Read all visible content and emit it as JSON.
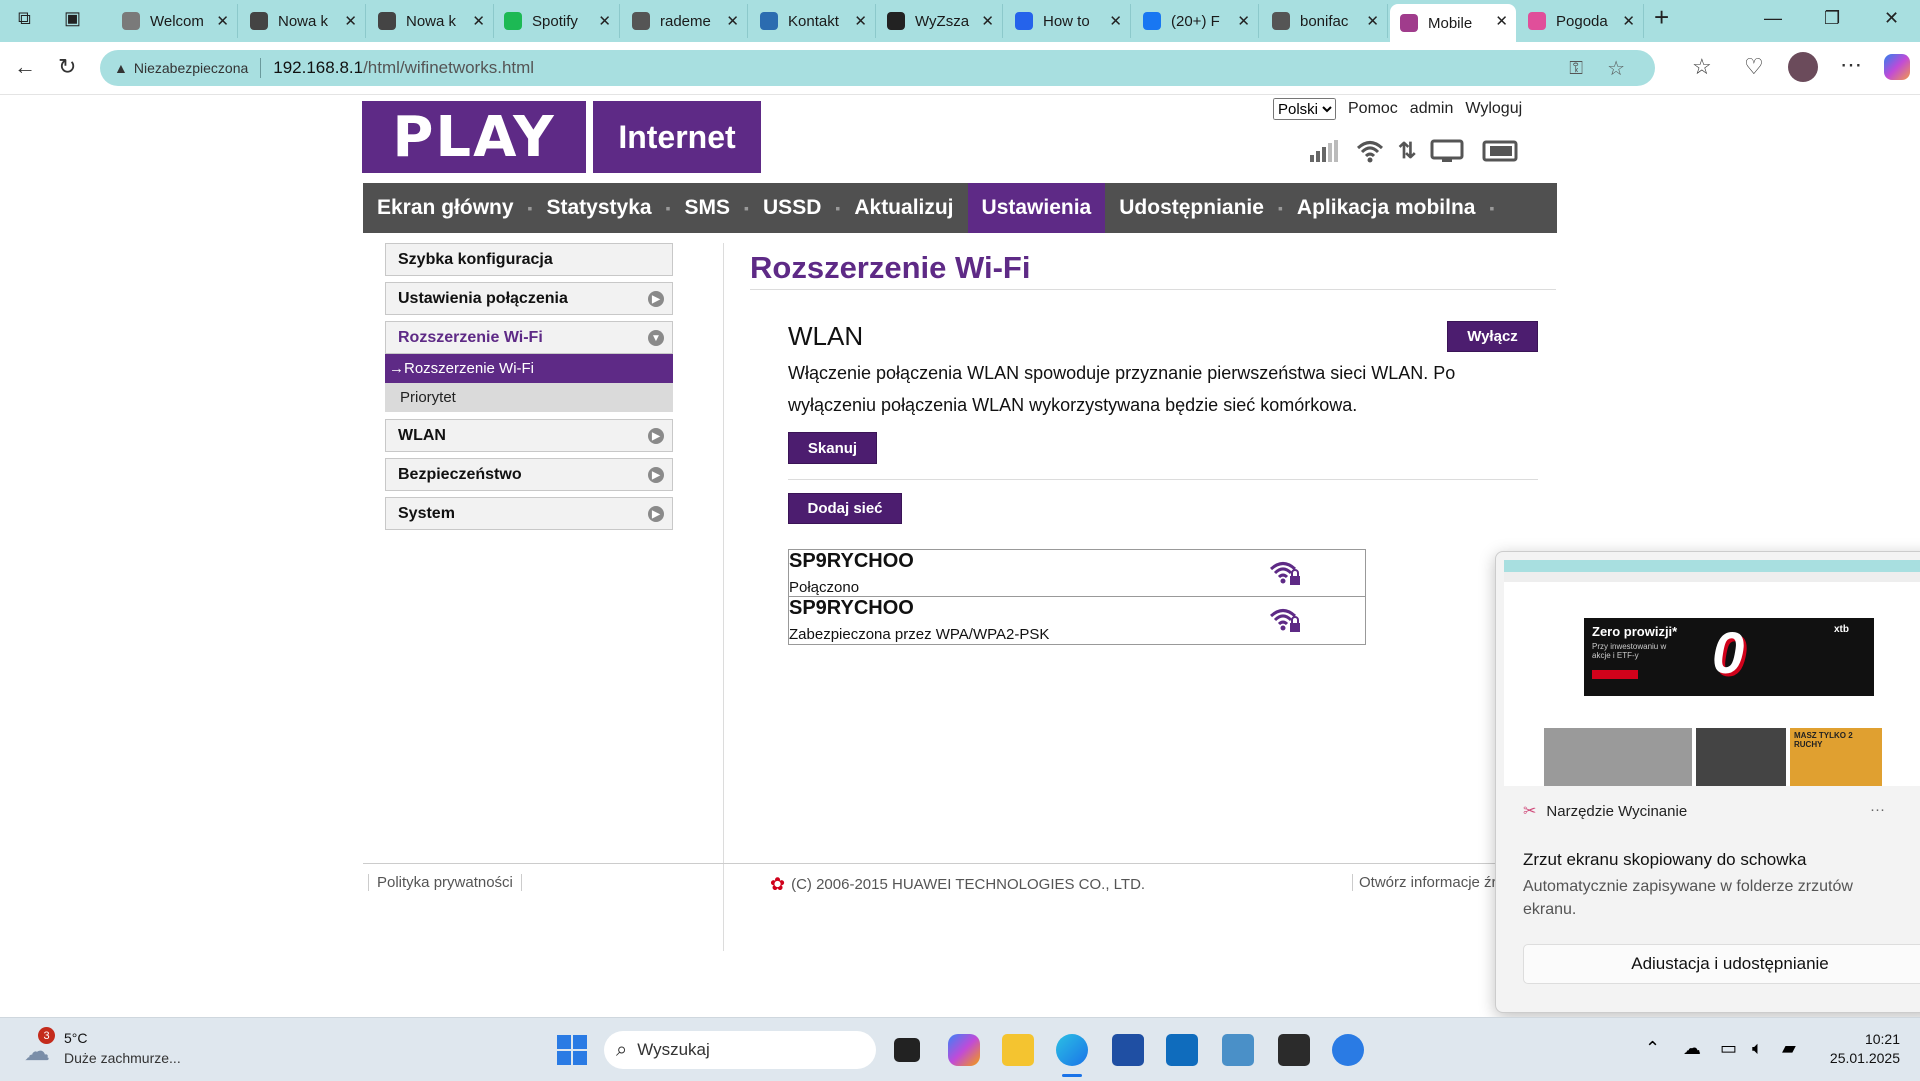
{
  "browser": {
    "tabs": [
      {
        "label": "Welcom",
        "icon": "globe-icon",
        "color": "#7a7a7a"
      },
      {
        "label": "Nowa k",
        "icon": "page-icon",
        "color": "#444444"
      },
      {
        "label": "Nowa k",
        "icon": "page-icon",
        "color": "#444444"
      },
      {
        "label": "Spotify",
        "icon": "spotify-icon",
        "color": "#1db954"
      },
      {
        "label": "rademe",
        "icon": "globe-icon",
        "color": "#555555"
      },
      {
        "label": "Kontakt",
        "icon": "hn-icon",
        "color": "#2b6cb0"
      },
      {
        "label": "WyZsza",
        "icon": "github-icon",
        "color": "#222222"
      },
      {
        "label": "How to",
        "icon": "l-icon",
        "color": "#2563eb"
      },
      {
        "label": "(20+) F",
        "icon": "facebook-icon",
        "color": "#1877f2"
      },
      {
        "label": "bonifac",
        "icon": "doc-icon",
        "color": "#555555"
      },
      {
        "label": "Mobile",
        "icon": "huawei-icon",
        "color": "#a03c8c",
        "active": true
      },
      {
        "label": "Pogoda",
        "icon": "weather-icon",
        "color": "#e04f9a"
      }
    ],
    "address": {
      "security": "Niezabezpieczona",
      "host": "192.168.8.1",
      "path": "/html/wifinetworks.html"
    }
  },
  "header": {
    "logo_play": "PLAY",
    "logo_internet": "Internet",
    "language": "Polski",
    "links": [
      "Pomoc",
      "admin",
      "Wyloguj"
    ]
  },
  "nav": {
    "items": [
      "Ekran główny",
      "Statystyka",
      "SMS",
      "USSD",
      "Aktualizuj",
      "Ustawienia",
      "Udostępnianie",
      "Aplikacja mobilna"
    ],
    "active": "Ustawienia"
  },
  "sidemenu": {
    "quick": "Szybka konfiguracja",
    "connection": "Ustawienia połączenia",
    "wifi_ext": "Rozszerzenie Wi-Fi",
    "wifi_ext_sub": "→Rozszerzenie Wi-Fi",
    "priority": "Priorytet",
    "wlan": "WLAN",
    "security": "Bezpieczeństwo",
    "system": "System"
  },
  "content": {
    "title": "Rozszerzenie Wi-Fi",
    "section": "WLAN",
    "toggle_button": "Wyłącz",
    "description": "Włączenie połączenia WLAN spowoduje przyznanie pierwszeństwa sieci WLAN. Po wyłączeniu połączenia WLAN wykorzystywana będzie sieć komórkowa.",
    "scan_button": "Skanuj",
    "add_button": "Dodaj sieć",
    "networks": [
      {
        "ssid": "SP9RYCHOO",
        "status": "Połączono"
      },
      {
        "ssid": "SP9RYCHOO",
        "status": "Zabezpieczona przez WPA/WPA2-PSK"
      }
    ]
  },
  "footer": {
    "privacy": "Polityka prywatności",
    "copyright": "(C) 2006-2015 HUAWEI TECHNOLOGIES CO., LTD.",
    "open_info": "Otwórz informacje źr"
  },
  "notification": {
    "app": "Narzędzie Wycinanie",
    "more": "···",
    "title": "Zrzut ekranu skopiowany do schowka",
    "body": "Automatycznie zapisywane w folderze zrzutów ekranu.",
    "button": "Adiustacja i udostępnianie",
    "thumb_ad_title": "Zero prowizji*",
    "thumb_ad_sub": "Przy inwestowaniu w akcje i ETF-y",
    "thumb_ad_zero": "0",
    "thumb_ad_brand": "xtb",
    "thumb_news": "MASZ TYLKO 2 RUCHY"
  },
  "taskbar": {
    "weather_badge": "3",
    "temperature": "5°C",
    "weather_desc": "Duże zachmurze...",
    "search_placeholder": "Wyszukaj",
    "time": "10:21",
    "date": "25.01.2025"
  },
  "colors": {
    "brand_purple": "#5e2a86",
    "browser_accent": "#a8dfe0",
    "nav_gray": "#505050"
  }
}
